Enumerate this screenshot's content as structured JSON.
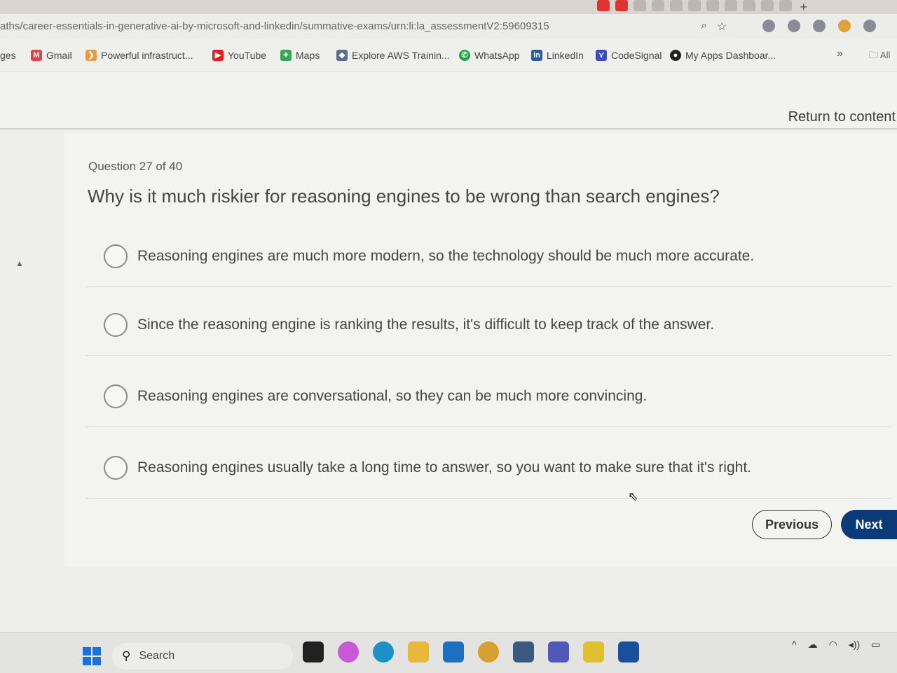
{
  "browser": {
    "url": "aths/career-essentials-in-generative-ai-by-microsoft-and-linkedin/summative-exams/urn:li:la_assessmentV2:59609315",
    "new_tab": "+",
    "bookmarks": [
      {
        "label": "ges",
        "icon": ""
      },
      {
        "label": "Gmail",
        "icon": "M"
      },
      {
        "label": "Powerful infrastruct...",
        "icon": "❯"
      },
      {
        "label": "YouTube",
        "icon": "▶"
      },
      {
        "label": "Maps",
        "icon": "✦"
      },
      {
        "label": "Explore AWS Trainin...",
        "icon": "◆"
      },
      {
        "label": "WhatsApp",
        "icon": "✆"
      },
      {
        "label": "LinkedIn",
        "icon": "in"
      },
      {
        "label": "CodeSignal",
        "icon": "⋎"
      },
      {
        "label": "My Apps Dashboar...",
        "icon": "●"
      }
    ],
    "bookmarks_more": "»",
    "all_bookmarks": "All"
  },
  "page": {
    "return_link": "Return to content",
    "question_number": "Question 27 of 40",
    "question_text": "Why is it much riskier for reasoning engines to be wrong than search engines?",
    "options": [
      "Reasoning engines are much more modern, so the technology should be much more accurate.",
      "Since the reasoning engine is ranking the results, it's difficult to keep track of the answer.",
      "Reasoning engines are conversational, so they can be much more convincing.",
      "Reasoning engines usually take a long time to answer, so you want to make sure that it's right."
    ],
    "previous_label": "Previous",
    "next_label": "Next"
  },
  "taskbar": {
    "search_placeholder": "Search"
  },
  "colors": {
    "next_button": "#0a3a78",
    "windows_logo": "#1a73d9"
  }
}
